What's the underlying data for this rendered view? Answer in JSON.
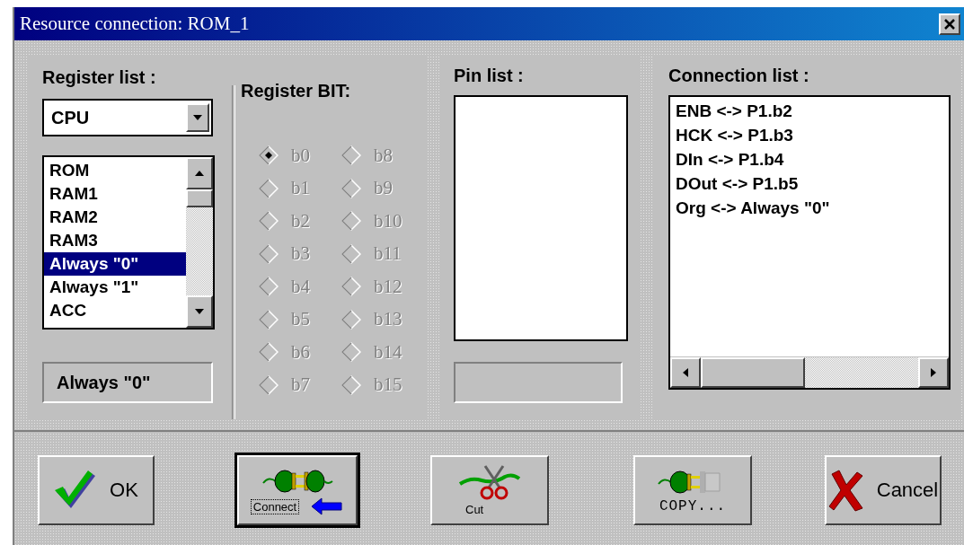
{
  "window": {
    "title": "Resource connection: ROM_1"
  },
  "register_panel": {
    "label": "Register list :",
    "dropdown": {
      "value": "CPU"
    },
    "registers": [
      {
        "label": "ROM",
        "selected": false
      },
      {
        "label": "RAM1",
        "selected": false
      },
      {
        "label": "RAM2",
        "selected": false
      },
      {
        "label": "RAM3",
        "selected": false
      },
      {
        "label": "Always \"0\"",
        "selected": true
      },
      {
        "label": "Always \"1\"",
        "selected": false
      },
      {
        "label": "ACC",
        "selected": false
      }
    ],
    "selected_value": "Always \"0\""
  },
  "bit_panel": {
    "label": "Register BIT:",
    "disabled": true,
    "bits": [
      {
        "label": "b0",
        "selected": true
      },
      {
        "label": "b1",
        "selected": false
      },
      {
        "label": "b2",
        "selected": false
      },
      {
        "label": "b3",
        "selected": false
      },
      {
        "label": "b4",
        "selected": false
      },
      {
        "label": "b5",
        "selected": false
      },
      {
        "label": "b6",
        "selected": false
      },
      {
        "label": "b7",
        "selected": false
      },
      {
        "label": "b8",
        "selected": false
      },
      {
        "label": "b9",
        "selected": false
      },
      {
        "label": "b10",
        "selected": false
      },
      {
        "label": "b11",
        "selected": false
      },
      {
        "label": "b12",
        "selected": false
      },
      {
        "label": "b13",
        "selected": false
      },
      {
        "label": "b14",
        "selected": false
      },
      {
        "label": "b15",
        "selected": false
      }
    ]
  },
  "pin_panel": {
    "label": "Pin list :"
  },
  "connection_panel": {
    "label": "Connection list :",
    "connections": [
      "ENB <-> P1.b2",
      "HCK <-> P1.b3",
      "DIn <-> P1.b4",
      "DOut <-> P1.b5",
      "Org <-> Always \"0\""
    ]
  },
  "buttons": [
    {
      "kind": "ok",
      "label": "OK",
      "default": false
    },
    {
      "kind": "connect",
      "label": "Connect",
      "default": true
    },
    {
      "kind": "cut",
      "label": "Cut",
      "default": false
    },
    {
      "kind": "copy",
      "label": "COPY...",
      "default": false
    },
    {
      "kind": "cancel",
      "label": "Cancel",
      "default": false
    }
  ]
}
